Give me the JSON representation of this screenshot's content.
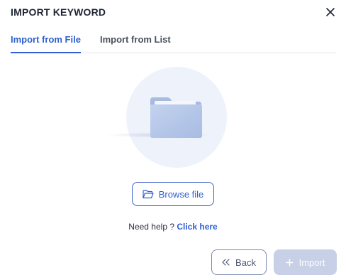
{
  "dialog": {
    "title": "IMPORT KEYWORD",
    "close_icon": "close-icon"
  },
  "tabs": [
    {
      "label": "Import from File",
      "active": true
    },
    {
      "label": "Import from List",
      "active": false
    }
  ],
  "illustration": {
    "icon": "folder-icon"
  },
  "browse": {
    "label": "Browse file",
    "icon": "folder-open-icon"
  },
  "help": {
    "text": "Need help ?",
    "link": "Click here"
  },
  "footer": {
    "back_label": "Back",
    "back_icon": "double-chevron-left-icon",
    "import_label": "Import",
    "import_icon": "plus-icon",
    "import_disabled": true
  },
  "colors": {
    "accent": "#2f5fd0",
    "disabled": "#c7d0e6"
  }
}
